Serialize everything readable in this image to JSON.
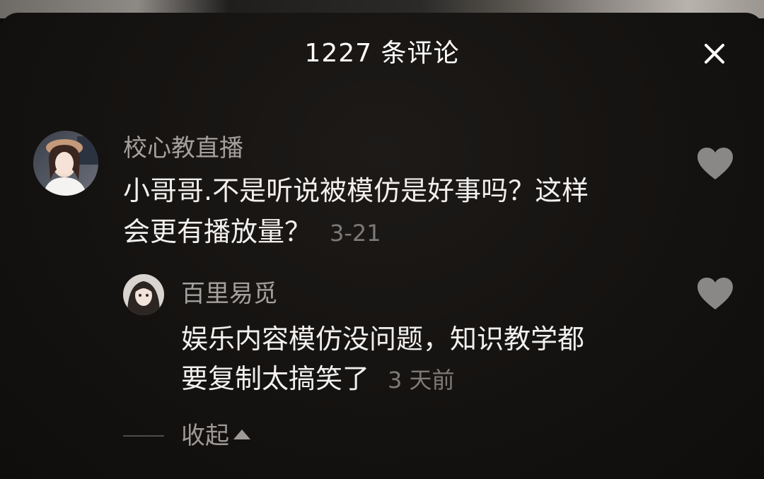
{
  "header": {
    "title": "1227 条评论",
    "close_icon": "close-icon"
  },
  "comments": [
    {
      "username": "校心教直播",
      "text_lines": [
        "小哥哥.不是听说被模仿是好事吗？这样",
        "会更有播放量？"
      ],
      "timestamp": "3-21",
      "like_icon": "heart-icon",
      "replies": [
        {
          "username": "百里易觅",
          "text_lines": [
            "娱乐内容模仿没问题，知识教学都",
            "要复制太搞笑了"
          ],
          "timestamp": "3 天前",
          "like_icon": "heart-icon"
        }
      ],
      "collapse_label": "收起"
    }
  ],
  "colors": {
    "background": "#141210",
    "title": "#ffffff",
    "username": "#a3a09d",
    "comment_text": "#f2f0ee",
    "timestamp": "#7e7a77",
    "like_icon": "#8a8886"
  }
}
